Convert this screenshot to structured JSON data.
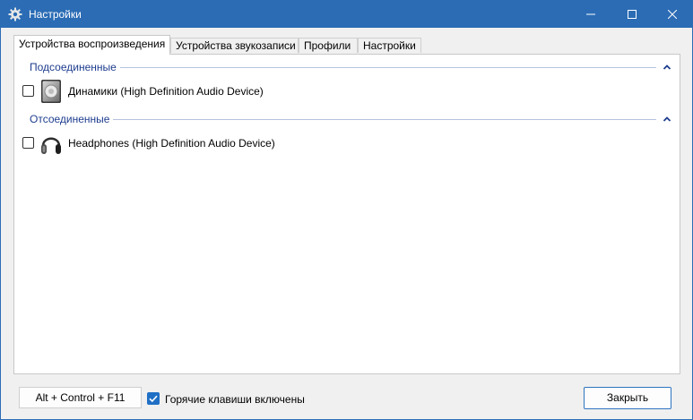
{
  "window": {
    "title": "Настройки",
    "icon": "gear-icon"
  },
  "tabs": [
    {
      "label": "Устройства воспроизведения",
      "active": true
    },
    {
      "label": "Устройства звукозаписи",
      "active": false
    },
    {
      "label": "Профили",
      "active": false
    },
    {
      "label": "Настройки",
      "active": false
    }
  ],
  "groups": {
    "connected": {
      "label": "Подсоединенные",
      "devices": [
        {
          "label": "Динамики (High Definition Audio Device)",
          "icon": "speaker-icon",
          "checked": false
        }
      ]
    },
    "disconnected": {
      "label": "Отсоединенные",
      "devices": [
        {
          "label": "Headphones (High Definition Audio Device)",
          "icon": "headphones-icon",
          "checked": false
        }
      ]
    }
  },
  "footer": {
    "hotkey": "Alt + Control + F11",
    "hotkeys_enabled_label": "Горячие клавиши включены",
    "hotkeys_enabled": true,
    "close_label": "Закрыть"
  },
  "colors": {
    "titlebar": "#2b6cb5",
    "group_text": "#1e3d8f",
    "accent": "#1f6fc5"
  }
}
